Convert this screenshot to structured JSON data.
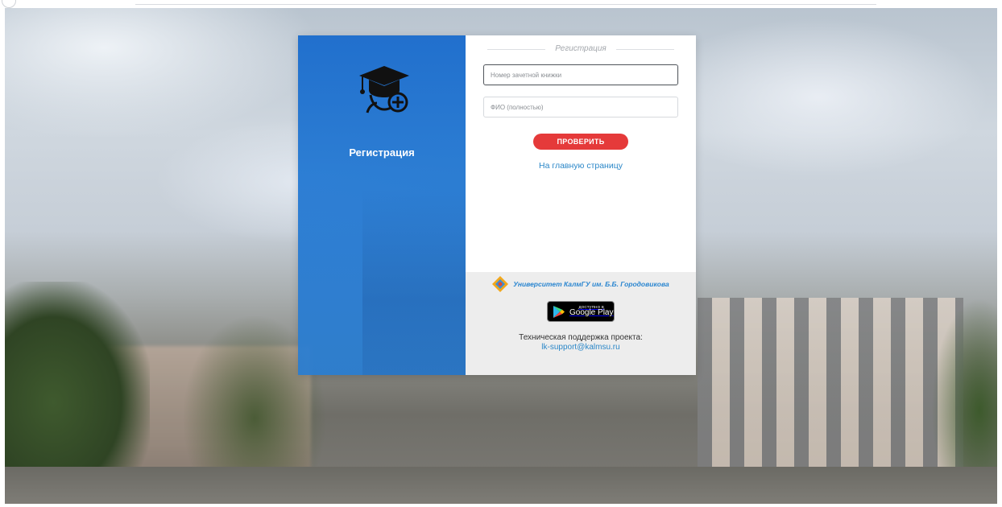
{
  "left_panel": {
    "icon": "graduation-cap-add-icon",
    "title": "Регистрация",
    "color": "#1e6ecd"
  },
  "form": {
    "section_title": "Регистрация",
    "record_book": {
      "value": "",
      "placeholder": "Номер зачетной книжки"
    },
    "full_name": {
      "value": "",
      "placeholder": "ФИО (полностью)"
    },
    "check_button": "ПРОВЕРИТЬ",
    "home_link": "На главную страницу",
    "accent_color": "#e53a3a",
    "link_color": "#2b87c8"
  },
  "footer": {
    "university_logo": "university-logo-icon",
    "university_name": "Университет КалмГУ им. Б.Б. Городовикова",
    "store_badge": {
      "icon": "google-play-icon",
      "small_text": "доступно в",
      "big_text": "Google Play"
    },
    "support_label": "Техническая поддержка проекта:",
    "support_email": "lk-support@kalmsu.ru"
  }
}
